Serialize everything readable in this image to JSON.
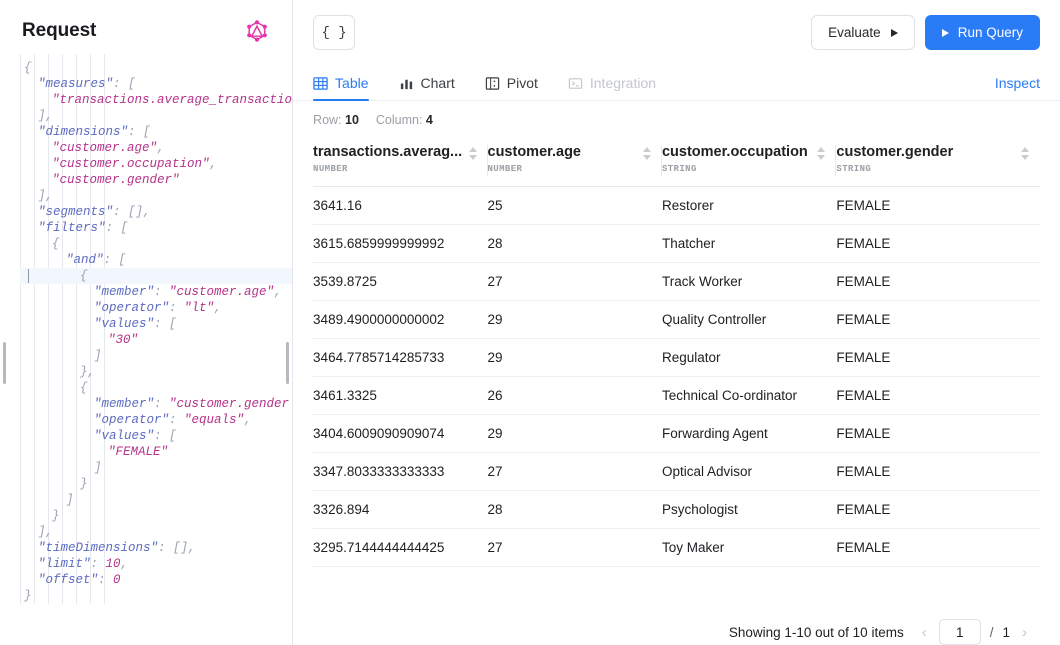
{
  "left_panel": {
    "title": "Request",
    "logo_icon": "graphql-icon",
    "logo_color": "#e535ab",
    "code_lines": [
      {
        "indent": 0,
        "parts": [
          {
            "t": "punct",
            "v": "{"
          }
        ]
      },
      {
        "indent": 1,
        "parts": [
          {
            "t": "key",
            "v": "\"measures\""
          },
          {
            "t": "punct",
            "v": ": ["
          }
        ]
      },
      {
        "indent": 2,
        "parts": [
          {
            "t": "str",
            "v": "\"transactions.average_transactio"
          }
        ]
      },
      {
        "indent": 1,
        "parts": [
          {
            "t": "punct",
            "v": "],"
          }
        ]
      },
      {
        "indent": 1,
        "parts": [
          {
            "t": "key",
            "v": "\"dimensions\""
          },
          {
            "t": "punct",
            "v": ": ["
          }
        ]
      },
      {
        "indent": 2,
        "parts": [
          {
            "t": "str",
            "v": "\"customer.age\""
          },
          {
            "t": "punct",
            "v": ","
          }
        ]
      },
      {
        "indent": 2,
        "parts": [
          {
            "t": "str",
            "v": "\"customer.occupation\""
          },
          {
            "t": "punct",
            "v": ","
          }
        ]
      },
      {
        "indent": 2,
        "parts": [
          {
            "t": "str",
            "v": "\"customer.gender\""
          }
        ]
      },
      {
        "indent": 1,
        "parts": [
          {
            "t": "punct",
            "v": "],"
          }
        ]
      },
      {
        "indent": 1,
        "parts": [
          {
            "t": "key",
            "v": "\"segments\""
          },
          {
            "t": "punct",
            "v": ": [],"
          }
        ]
      },
      {
        "indent": 1,
        "parts": [
          {
            "t": "key",
            "v": "\"filters\""
          },
          {
            "t": "punct",
            "v": ": ["
          }
        ]
      },
      {
        "indent": 2,
        "parts": [
          {
            "t": "punct",
            "v": "{"
          }
        ]
      },
      {
        "indent": 3,
        "parts": [
          {
            "t": "key",
            "v": "\"and\""
          },
          {
            "t": "punct",
            "v": ": ["
          }
        ]
      },
      {
        "indent": 4,
        "active": true,
        "parts": [
          {
            "t": "punct",
            "v": "{"
          }
        ]
      },
      {
        "indent": 5,
        "parts": [
          {
            "t": "key",
            "v": "\"member\""
          },
          {
            "t": "punct",
            "v": ": "
          },
          {
            "t": "str",
            "v": "\"customer.age\""
          },
          {
            "t": "punct",
            "v": ","
          }
        ]
      },
      {
        "indent": 5,
        "parts": [
          {
            "t": "key",
            "v": "\"operator\""
          },
          {
            "t": "punct",
            "v": ": "
          },
          {
            "t": "str",
            "v": "\"lt\""
          },
          {
            "t": "punct",
            "v": ","
          }
        ]
      },
      {
        "indent": 5,
        "parts": [
          {
            "t": "key",
            "v": "\"values\""
          },
          {
            "t": "punct",
            "v": ": ["
          }
        ]
      },
      {
        "indent": 6,
        "parts": [
          {
            "t": "str",
            "v": "\"30\""
          }
        ]
      },
      {
        "indent": 5,
        "parts": [
          {
            "t": "punct",
            "v": "]"
          }
        ]
      },
      {
        "indent": 4,
        "parts": [
          {
            "t": "punct",
            "v": "},"
          }
        ]
      },
      {
        "indent": 4,
        "parts": [
          {
            "t": "punct",
            "v": "{"
          }
        ]
      },
      {
        "indent": 5,
        "parts": [
          {
            "t": "key",
            "v": "\"member\""
          },
          {
            "t": "punct",
            "v": ": "
          },
          {
            "t": "str",
            "v": "\"customer.gender"
          }
        ]
      },
      {
        "indent": 5,
        "parts": [
          {
            "t": "key",
            "v": "\"operator\""
          },
          {
            "t": "punct",
            "v": ": "
          },
          {
            "t": "str",
            "v": "\"equals\""
          },
          {
            "t": "punct",
            "v": ","
          }
        ]
      },
      {
        "indent": 5,
        "parts": [
          {
            "t": "key",
            "v": "\"values\""
          },
          {
            "t": "punct",
            "v": ": ["
          }
        ]
      },
      {
        "indent": 6,
        "parts": [
          {
            "t": "str",
            "v": "\"FEMALE\""
          }
        ]
      },
      {
        "indent": 5,
        "parts": [
          {
            "t": "punct",
            "v": "]"
          }
        ]
      },
      {
        "indent": 4,
        "parts": [
          {
            "t": "punct",
            "v": "}"
          }
        ]
      },
      {
        "indent": 3,
        "parts": [
          {
            "t": "punct",
            "v": "]"
          }
        ]
      },
      {
        "indent": 2,
        "parts": [
          {
            "t": "punct",
            "v": "}"
          }
        ]
      },
      {
        "indent": 1,
        "parts": [
          {
            "t": "punct",
            "v": "],"
          }
        ]
      },
      {
        "indent": 1,
        "parts": [
          {
            "t": "key",
            "v": "\"timeDimensions\""
          },
          {
            "t": "punct",
            "v": ": [],"
          }
        ]
      },
      {
        "indent": 1,
        "parts": [
          {
            "t": "key",
            "v": "\"limit\""
          },
          {
            "t": "punct",
            "v": ": "
          },
          {
            "t": "num",
            "v": "10"
          },
          {
            "t": "punct",
            "v": ","
          }
        ]
      },
      {
        "indent": 1,
        "parts": [
          {
            "t": "key",
            "v": "\"offset\""
          },
          {
            "t": "punct",
            "v": ": "
          },
          {
            "t": "num",
            "v": "0"
          }
        ]
      },
      {
        "indent": 0,
        "parts": [
          {
            "t": "punct",
            "v": "}"
          }
        ]
      }
    ]
  },
  "toolbar": {
    "json_button_label": "{ }",
    "evaluate_label": "Evaluate",
    "run_query_label": "Run Query",
    "run_query_color": "#2a7bf6"
  },
  "tabs": [
    {
      "label": "Table",
      "icon": "table-grid-icon",
      "active": true,
      "disabled": false
    },
    {
      "label": "Chart",
      "icon": "bar-chart-icon",
      "active": false,
      "disabled": false
    },
    {
      "label": "Pivot",
      "icon": "pivot-grid-icon",
      "active": false,
      "disabled": false
    },
    {
      "label": "Integration",
      "icon": "terminal-icon",
      "active": false,
      "disabled": true
    }
  ],
  "inspect_label": "Inspect",
  "meta": {
    "row_label": "Row:",
    "row_value": "10",
    "column_label": "Column:",
    "column_value": "4"
  },
  "table": {
    "columns": [
      {
        "name": "transactions.averag...",
        "type": "NUMBER"
      },
      {
        "name": "customer.age",
        "type": "NUMBER"
      },
      {
        "name": "customer.occupation",
        "type": "STRING"
      },
      {
        "name": "customer.gender",
        "type": "STRING"
      }
    ],
    "rows": [
      [
        "3641.16",
        "25",
        "Restorer",
        "FEMALE"
      ],
      [
        "3615.6859999999992",
        "28",
        "Thatcher",
        "FEMALE"
      ],
      [
        "3539.8725",
        "27",
        "Track Worker",
        "FEMALE"
      ],
      [
        "3489.4900000000002",
        "29",
        "Quality Controller",
        "FEMALE"
      ],
      [
        "3464.7785714285733",
        "29",
        "Regulator",
        "FEMALE"
      ],
      [
        "3461.3325",
        "26",
        "Technical Co-ordinator",
        "FEMALE"
      ],
      [
        "3404.6009090909074",
        "29",
        "Forwarding Agent",
        "FEMALE"
      ],
      [
        "3347.8033333333333",
        "27",
        "Optical Advisor",
        "FEMALE"
      ],
      [
        "3326.894",
        "28",
        "Psychologist",
        "FEMALE"
      ],
      [
        "3295.7144444444425",
        "27",
        "Toy Maker",
        "FEMALE"
      ]
    ]
  },
  "pagination": {
    "showing_text": "Showing 1-10 out of 10 items",
    "prev_icon": "chevron-left-icon",
    "next_icon": "chevron-right-icon",
    "current_page": "1",
    "separator": "/",
    "total_pages": "1"
  }
}
